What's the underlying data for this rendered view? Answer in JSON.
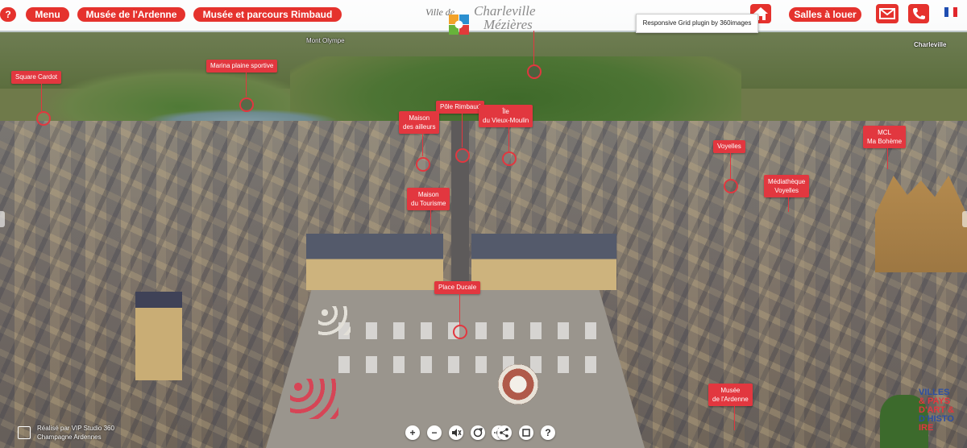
{
  "header": {
    "help_label": "?",
    "menu_label": "Menu",
    "museum_label": "Musée de l'Ardenne",
    "rimbaud_label": "Musée et parcours Rimbaud",
    "rooms_label": "Salles à louer",
    "logo": {
      "prefix": "Ville de",
      "line1": "Charleville",
      "line2": "Mézières"
    },
    "tooltip": "Responsive Grid plugin by 360images",
    "colors": {
      "accent": "#e5322d"
    }
  },
  "places": {
    "mont_olympe": "Mont Olympe",
    "charleville": "Charleville"
  },
  "hotspots": [
    {
      "id": "square-cardot",
      "label": "Square Cardot"
    },
    {
      "id": "marina",
      "label": "Marina plaine sportive"
    },
    {
      "id": "pole-rimbaud",
      "label": "Pôle Rimbaud"
    },
    {
      "id": "maison-ailleurs",
      "label": "Maison\ndes ailleurs"
    },
    {
      "id": "vieux-moulin",
      "label": "Île\ndu Vieux-Moulin"
    },
    {
      "id": "voyelles",
      "label": "Voyelles"
    },
    {
      "id": "mcl",
      "label": "MCL\nMa Bohème"
    },
    {
      "id": "mediatheque",
      "label": "Médiathèque\nVoyelles"
    },
    {
      "id": "maison-tourisme",
      "label": "Maison\ndu Tourisme"
    },
    {
      "id": "place-ducale",
      "label": "Place Ducale"
    },
    {
      "id": "musee-ardenne",
      "label": "Musée\nde l'Ardenne"
    }
  ],
  "controls": {
    "zoom_in": "+",
    "zoom_out": "−",
    "sound": "🔈",
    "autorotate": "↻",
    "share": "⋈",
    "fullscreen": "⛶",
    "info": "?"
  },
  "credit": {
    "line1": "Réalisé par VIP Studio 360",
    "line2": "Champagne Ardennes"
  },
  "badge": {
    "lines": [
      "VILLES",
      "& PAYS",
      "D'ART &",
      "D'HISTO",
      "IRE"
    ]
  }
}
